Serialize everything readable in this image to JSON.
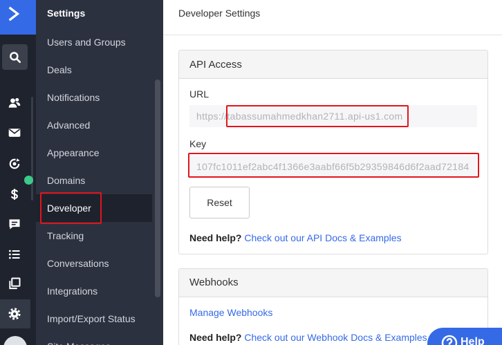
{
  "app": {
    "logo_icon": "activecampaign-logo-icon"
  },
  "rail": {
    "items": [
      {
        "icon": "search-icon"
      },
      {
        "icon": "contacts-icon"
      },
      {
        "icon": "mail-icon"
      },
      {
        "icon": "automation-icon"
      },
      {
        "icon": "dollar-icon"
      },
      {
        "icon": "chat-icon"
      },
      {
        "icon": "list-icon"
      },
      {
        "icon": "window-icon"
      },
      {
        "icon": "gear-icon",
        "selected": true
      },
      {
        "icon": "avatar"
      }
    ],
    "notification_dot": true
  },
  "settings_nav": {
    "title": "Settings",
    "items": [
      {
        "label": "Users and Groups"
      },
      {
        "label": "Deals"
      },
      {
        "label": "Notifications"
      },
      {
        "label": "Advanced"
      },
      {
        "label": "Appearance"
      },
      {
        "label": "Domains"
      },
      {
        "label": "Developer",
        "active": true
      },
      {
        "label": "Tracking"
      },
      {
        "label": "Conversations"
      },
      {
        "label": "Integrations"
      },
      {
        "label": "Import/Export Status"
      },
      {
        "label": "Site Messages"
      }
    ]
  },
  "page": {
    "title": "Developer Settings"
  },
  "api_access": {
    "title": "API Access",
    "url": {
      "label": "URL",
      "value": "https://tabassumahmedkhan2711.api-us1.com"
    },
    "key": {
      "label": "Key",
      "value": "107fc1011ef2abc4f1366e3aabf66f5b29359846d6f2aad72184"
    },
    "reset_label": "Reset",
    "help": {
      "prefix": "Need help?",
      "link": "Check out our API Docs & Examples"
    }
  },
  "webhooks": {
    "title": "Webhooks",
    "manage_link": "Manage Webhooks",
    "help": {
      "prefix": "Need help?",
      "link": "Check out our Webhook Docs & Examples"
    }
  },
  "help_button": {
    "label": "Help",
    "icon": "question-circle-icon"
  },
  "colors": {
    "brand": "#356ae6",
    "rail_bg": "#1f232e",
    "nav_bg": "#2c3140",
    "nav_active_bg": "#1e222c",
    "link": "#356ae6",
    "notification_dot": "#3cc98a",
    "annotation": "#e3141b"
  }
}
